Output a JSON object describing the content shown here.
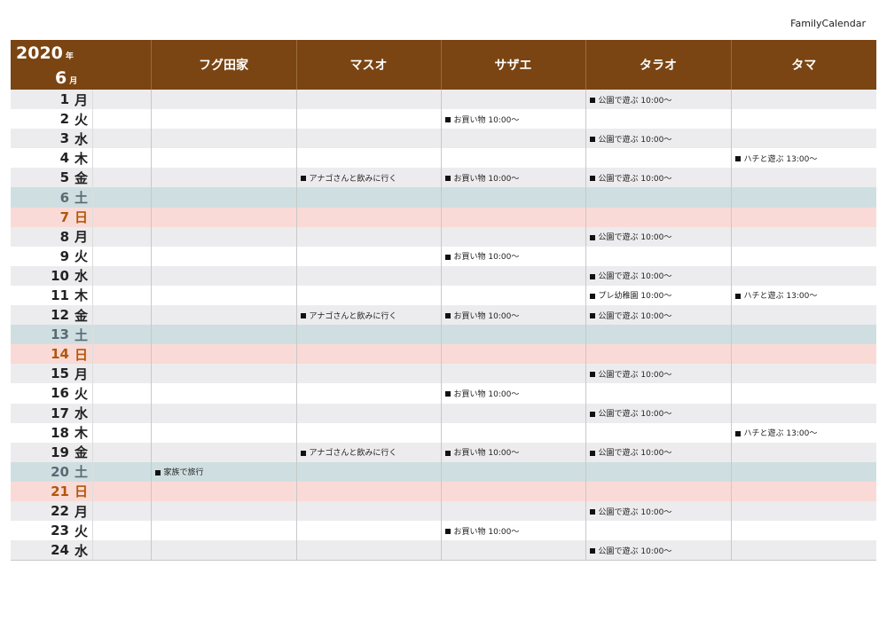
{
  "app_title": "FamilyCalendar",
  "header": {
    "year": "2020",
    "year_unit": "年",
    "month": "6",
    "month_unit": "月",
    "members": [
      "フグ田家",
      "マスオ",
      "サザエ",
      "タラオ",
      "タマ"
    ]
  },
  "colors": {
    "header_bg": "#7a4513",
    "weekday_alt": "#ececee",
    "saturday_bg": "#cfdfe1",
    "sunday_bg": "#fadad6"
  },
  "days": [
    {
      "num": "1",
      "dow": "月",
      "type": "weekday",
      "events": [
        "",
        "",
        "",
        "公園で遊ぶ 10:00〜",
        ""
      ]
    },
    {
      "num": "2",
      "dow": "火",
      "type": "weekday",
      "events": [
        "",
        "",
        "お買い物 10:00〜",
        "",
        ""
      ]
    },
    {
      "num": "3",
      "dow": "水",
      "type": "weekday",
      "events": [
        "",
        "",
        "",
        "公園で遊ぶ 10:00〜",
        ""
      ]
    },
    {
      "num": "4",
      "dow": "木",
      "type": "weekday",
      "events": [
        "",
        "",
        "",
        "",
        "ハチと遊ぶ 13:00〜"
      ]
    },
    {
      "num": "5",
      "dow": "金",
      "type": "weekday",
      "events": [
        "",
        "アナゴさんと飲みに行く",
        "お買い物 10:00〜",
        "公園で遊ぶ 10:00〜",
        ""
      ]
    },
    {
      "num": "6",
      "dow": "土",
      "type": "sat",
      "events": [
        "",
        "",
        "",
        "",
        ""
      ]
    },
    {
      "num": "7",
      "dow": "日",
      "type": "sun",
      "events": [
        "",
        "",
        "",
        "",
        ""
      ]
    },
    {
      "num": "8",
      "dow": "月",
      "type": "weekday",
      "events": [
        "",
        "",
        "",
        "公園で遊ぶ 10:00〜",
        ""
      ]
    },
    {
      "num": "9",
      "dow": "火",
      "type": "weekday",
      "events": [
        "",
        "",
        "お買い物 10:00〜",
        "",
        ""
      ]
    },
    {
      "num": "10",
      "dow": "水",
      "type": "weekday",
      "events": [
        "",
        "",
        "",
        "公園で遊ぶ 10:00〜",
        ""
      ]
    },
    {
      "num": "11",
      "dow": "木",
      "type": "weekday",
      "events": [
        "",
        "",
        "",
        "プレ幼稚園 10:00〜",
        "ハチと遊ぶ 13:00〜"
      ]
    },
    {
      "num": "12",
      "dow": "金",
      "type": "weekday",
      "events": [
        "",
        "アナゴさんと飲みに行く",
        "お買い物 10:00〜",
        "公園で遊ぶ 10:00〜",
        ""
      ]
    },
    {
      "num": "13",
      "dow": "土",
      "type": "sat",
      "events": [
        "",
        "",
        "",
        "",
        ""
      ]
    },
    {
      "num": "14",
      "dow": "日",
      "type": "sun",
      "events": [
        "",
        "",
        "",
        "",
        ""
      ]
    },
    {
      "num": "15",
      "dow": "月",
      "type": "weekday",
      "events": [
        "",
        "",
        "",
        "公園で遊ぶ 10:00〜",
        ""
      ]
    },
    {
      "num": "16",
      "dow": "火",
      "type": "weekday",
      "events": [
        "",
        "",
        "お買い物 10:00〜",
        "",
        ""
      ]
    },
    {
      "num": "17",
      "dow": "水",
      "type": "weekday",
      "events": [
        "",
        "",
        "",
        "公園で遊ぶ 10:00〜",
        ""
      ]
    },
    {
      "num": "18",
      "dow": "木",
      "type": "weekday",
      "events": [
        "",
        "",
        "",
        "",
        "ハチと遊ぶ 13:00〜"
      ]
    },
    {
      "num": "19",
      "dow": "金",
      "type": "weekday",
      "events": [
        "",
        "アナゴさんと飲みに行く",
        "お買い物 10:00〜",
        "公園で遊ぶ 10:00〜",
        ""
      ]
    },
    {
      "num": "20",
      "dow": "土",
      "type": "sat",
      "events": [
        "家族で旅行",
        "",
        "",
        "",
        ""
      ]
    },
    {
      "num": "21",
      "dow": "日",
      "type": "sun",
      "events": [
        "",
        "",
        "",
        "",
        ""
      ]
    },
    {
      "num": "22",
      "dow": "月",
      "type": "weekday",
      "events": [
        "",
        "",
        "",
        "公園で遊ぶ 10:00〜",
        ""
      ]
    },
    {
      "num": "23",
      "dow": "火",
      "type": "weekday",
      "events": [
        "",
        "",
        "お買い物 10:00〜",
        "",
        ""
      ]
    },
    {
      "num": "24",
      "dow": "水",
      "type": "weekday",
      "events": [
        "",
        "",
        "",
        "公園で遊ぶ 10:00〜",
        ""
      ]
    }
  ]
}
